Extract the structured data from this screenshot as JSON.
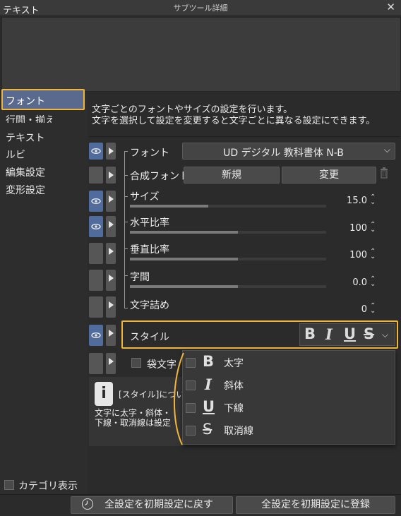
{
  "window": {
    "title": "サブツール詳細",
    "close_glyph": "✕"
  },
  "preview": {
    "text": "テキスト"
  },
  "categories": {
    "items": [
      "フォント",
      "行間・揃え",
      "テキスト",
      "ルビ",
      "編集設定",
      "変形設定"
    ],
    "selected": "フォント",
    "show_category_label": "カテゴリ表示"
  },
  "description": {
    "line1": "文字ごとのフォントやサイズの設定を行います。",
    "line2": "文字を選択して設定を変更すると文字ごとに異なる設定にできます。"
  },
  "settings": {
    "font": {
      "label": "フォント",
      "value": "UD デジタル 教科書体 N-B",
      "eye_on": true
    },
    "composite_font": {
      "label": "合成フォント",
      "new_label": "新規",
      "change_label": "変更",
      "eye_on": false
    },
    "size": {
      "label": "サイズ",
      "value": "15.0",
      "fill": 0.4,
      "eye_on": true
    },
    "horizontal_ratio": {
      "label": "水平比率",
      "value": "100",
      "fill": 0.55,
      "eye_on": true
    },
    "vertical_ratio": {
      "label": "垂直比率",
      "value": "100",
      "fill": 0.55,
      "eye_on": false
    },
    "spacing": {
      "label": "字間",
      "value": "0.0",
      "fill": 0.55,
      "eye_on": false
    },
    "kerning": {
      "label": "文字詰め",
      "value": "0",
      "fill": 0,
      "eye_on": false
    },
    "style": {
      "label": "スタイル",
      "eye_on": true
    },
    "outline": {
      "label": "袋文字"
    }
  },
  "style_menu": [
    {
      "glyph": "B",
      "label": "太字"
    },
    {
      "glyph": "I",
      "label": "斜体"
    },
    {
      "glyph": "U",
      "label": "下線"
    },
    {
      "glyph": "S",
      "label": "取消線"
    }
  ],
  "info": {
    "icon": "i",
    "title": "[スタイル]につい",
    "body_line1": "文字に太字・斜体・",
    "body_line2": "下線・取消線は設定"
  },
  "footer": {
    "reset_label": "全設定を初期設定に戻す",
    "register_label": "全設定を初期設定に登録"
  },
  "colors": {
    "accent_highlight": "#f1b53a",
    "eye_on": "#4f6c9c",
    "selected_category": "#5a6a8e"
  }
}
